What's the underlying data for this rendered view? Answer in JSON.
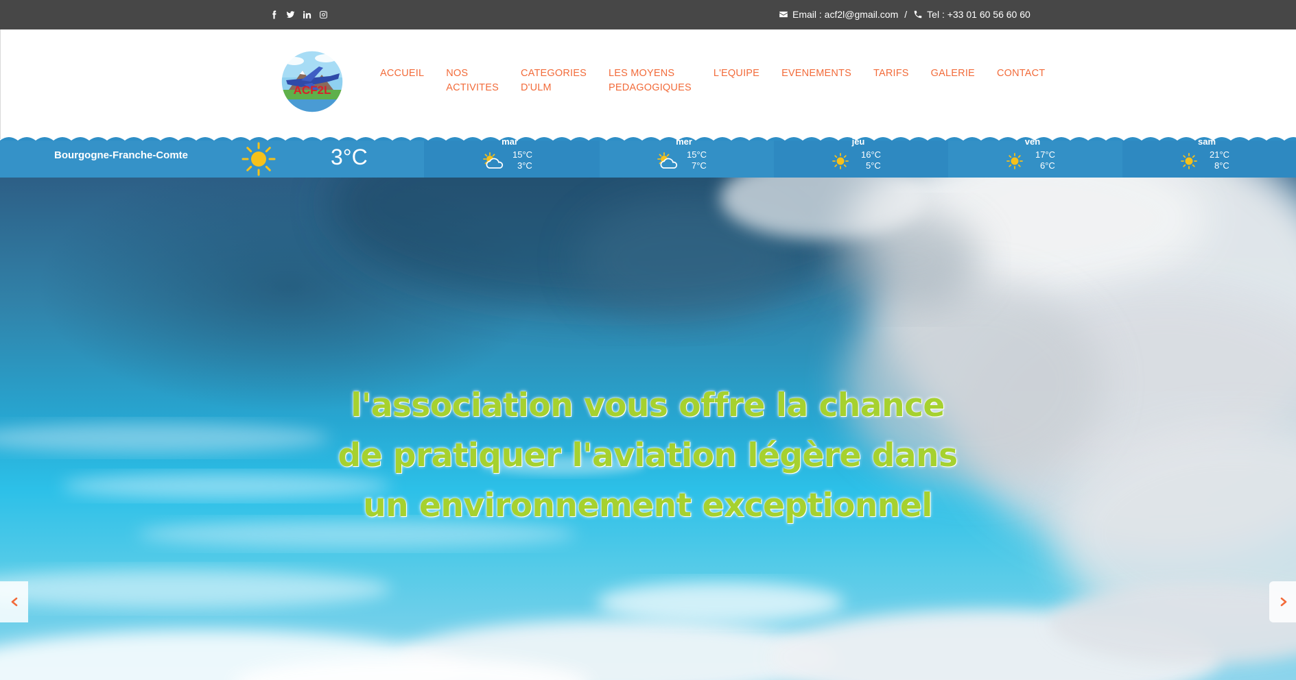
{
  "topbar": {
    "social": [
      "facebook-icon",
      "twitter-icon",
      "linkedin-icon",
      "instagram-icon"
    ],
    "email": "Email : acf2l@gmail.com",
    "separator": "/",
    "phone": "Tel : +33 01 60 56 60 60"
  },
  "header": {
    "logo_text": "ACF2L",
    "nav": [
      {
        "label": "ACCUEIL"
      },
      {
        "label": "NOS\nACTIVITES"
      },
      {
        "label": "CATEGORIES\nD'ULM"
      },
      {
        "label": "LES MOYENS\nPEDAGOGIQUES"
      },
      {
        "label": "L'EQUIPE"
      },
      {
        "label": "EVENEMENTS"
      },
      {
        "label": "TARIFS"
      },
      {
        "label": "GALERIE"
      },
      {
        "label": "CONTACT"
      }
    ]
  },
  "weather": {
    "location": "Bourgogne-Franche-Comte",
    "current_icon": "sun-icon",
    "current_temp": "3°C",
    "forecast": [
      {
        "day": "mar",
        "icon": "partly-cloudy-icon",
        "hi": "15°C",
        "lo": "3°C"
      },
      {
        "day": "mer",
        "icon": "partly-cloudy-icon",
        "hi": "15°C",
        "lo": "7°C"
      },
      {
        "day": "jeu",
        "icon": "sun-icon",
        "hi": "16°C",
        "lo": "5°C"
      },
      {
        "day": "ven",
        "icon": "sun-icon",
        "hi": "17°C",
        "lo": "6°C"
      },
      {
        "day": "sam",
        "icon": "sun-icon",
        "hi": "21°C",
        "lo": "8°C"
      }
    ]
  },
  "hero": {
    "headline": "l'association vous offre la chance\nde pratiquer l'aviation légère dans\nun environnement exceptionnel",
    "prev_icon": "chevron-left-icon",
    "next_icon": "chevron-right-icon"
  },
  "colors": {
    "topbar": "#474747",
    "nav_accent": "#f26b3a",
    "weather": "#2e8ec6",
    "headline": "#a6d12f"
  }
}
